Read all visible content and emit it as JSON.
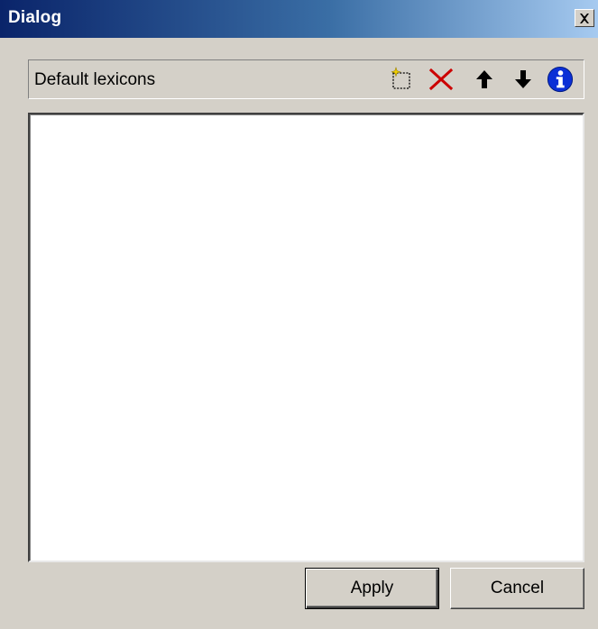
{
  "window": {
    "title": "Dialog"
  },
  "lexicons": {
    "label": "Default lexicons",
    "tools": [
      {
        "name": "new-lexicon",
        "icon": "new-document-sparkle-icon"
      },
      {
        "name": "delete-lexicon",
        "icon": "red-x-icon"
      },
      {
        "name": "move-up",
        "icon": "arrow-up-icon"
      },
      {
        "name": "move-down",
        "icon": "arrow-down-icon"
      },
      {
        "name": "info",
        "icon": "info-icon"
      }
    ],
    "items": []
  },
  "buttons": {
    "apply_label": "Apply",
    "cancel_label": "Cancel"
  },
  "colors": {
    "titlebar_start": "#0a246a",
    "titlebar_end": "#a6caf0",
    "face": "#d4d0c8",
    "delete_red": "#cc0000",
    "info_blue": "#0b2fd6"
  }
}
